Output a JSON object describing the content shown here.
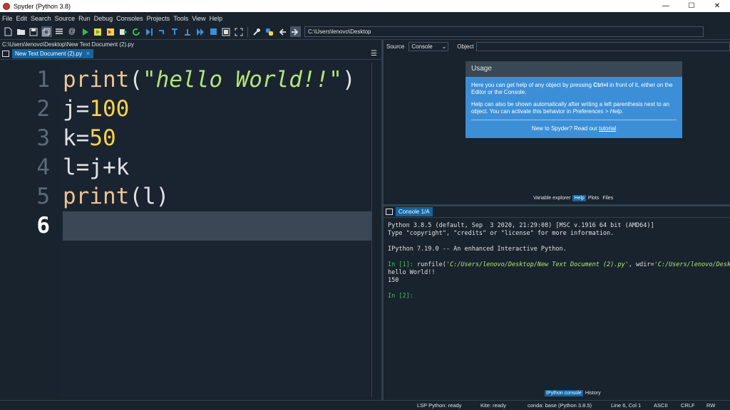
{
  "window": {
    "title": "Spyder (Python 3.8)",
    "min": "—",
    "max": "☐",
    "close": "✕"
  },
  "menu": [
    "File",
    "Edit",
    "Search",
    "Source",
    "Run",
    "Debug",
    "Consoles",
    "Projects",
    "Tools",
    "View",
    "Help"
  ],
  "toolbar": {
    "path": "C:\\Users\\lenovo\\Desktop"
  },
  "editor": {
    "file_path": "C:\\Users\\lenovo\\Desktop\\New Text Document (2).py",
    "tab_label": "New Text Document (2).py",
    "tab_close": "✕",
    "options_icon": "☰",
    "lines": [
      {
        "n": "1",
        "segments": [
          [
            "kw",
            "print"
          ],
          [
            "op",
            "("
          ],
          [
            "str",
            "\"hello World!!\""
          ],
          [
            "op",
            ")"
          ]
        ]
      },
      {
        "n": "2",
        "segments": [
          [
            "op",
            "j="
          ],
          [
            "num",
            "100"
          ]
        ]
      },
      {
        "n": "3",
        "segments": [
          [
            "op",
            "k="
          ],
          [
            "num",
            "50"
          ]
        ]
      },
      {
        "n": "4",
        "segments": [
          [
            "op",
            "l=j+k"
          ]
        ]
      },
      {
        "n": "5",
        "segments": [
          [
            "kw",
            "print"
          ],
          [
            "op",
            "(l)"
          ]
        ]
      },
      {
        "n": "6",
        "segments": []
      }
    ],
    "current_line": "6"
  },
  "help": {
    "source_label": "Source",
    "source_value": "Console",
    "object_label": "Object",
    "usage_title": "Usage",
    "p1_pre": "Here you can get help of any object by pressing ",
    "p1_bold": "Ctrl+I",
    "p1_post": " in front of it, either on the Editor or the Console.",
    "p2_pre": "Help can also be shown automatically after writing a left parenthesis next to an object. You can activate this behavior in ",
    "p2_em": "Preferences > Help",
    "p2_post": ".",
    "foot_pre": "New to Spyder? Read our ",
    "foot_link": "tutorial",
    "tabs": [
      "Variable explorer",
      "Help",
      "Plots",
      "Files"
    ],
    "active_tab": "Help"
  },
  "console": {
    "tab_label": "Console 1/A",
    "l1": "Python 3.8.5 (default, Sep  3 2020, 21:29:08) [MSC v.1916 64 bit (AMD64)]",
    "l2": "Type \"copyright\", \"credits\" or \"license\" for more information.",
    "l3": "IPython 7.19.0 -- An enhanced Interactive Python.",
    "in1": "In [1]:",
    "run_pre": " runfile(",
    "run_arg1": "'C:/Users/lenovo/Desktop/New Text Document (2).py'",
    "run_mid": ", wdir=",
    "run_arg2": "'C:/Users/lenovo/Deskto",
    "out1": "hello World!!",
    "out2": "150",
    "in2": "In [2]:",
    "tabs": [
      "IPython console",
      "History"
    ],
    "active_tab": "IPython console"
  },
  "status": {
    "lsp": "LSP Python: ready",
    "kite": "Kite: ready",
    "conda": "conda: base (Python 3.8.5)",
    "position": "Line 6, Col 1",
    "encoding": "ASCII",
    "eol": "CRLF",
    "mode": "RW"
  },
  "colors": {
    "background": "#19232d",
    "accent": "#1464a0",
    "usage_box": "#3c8fd6",
    "keyword": "#eec492",
    "string": "#b5e37a",
    "number": "#fad34a",
    "prompt": "#41c25d"
  }
}
